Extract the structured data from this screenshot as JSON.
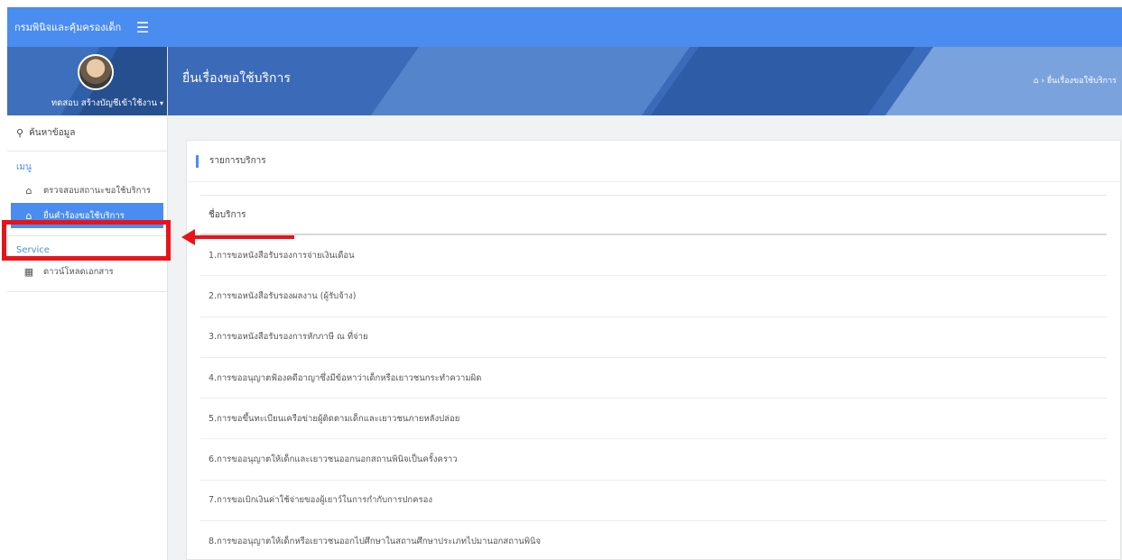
{
  "topbar": {
    "brand": "กรมพินิจและคุ้มครองเด็ก",
    "menu_icon": "hamburger-icon"
  },
  "profile": {
    "username": "ทดสอบ สร้างบัญชีเข้าใช้งาน",
    "caret": "▾"
  },
  "sidebar": {
    "search_label": "ค้นหาข้อมูล",
    "menu_section": "เมนู",
    "items": [
      {
        "label": "ตรวจสอบสถานะขอใช้บริการ",
        "icon": "home-icon"
      },
      {
        "label": "ยื่นคำร้องขอใช้บริการ",
        "icon": "home-icon"
      }
    ],
    "service_section": "Service",
    "service_items": [
      {
        "label": "ดาวน์โหลดเอกสาร",
        "icon": "grid-icon"
      }
    ]
  },
  "banner": {
    "title": "ยื่นเรื่องขอใช้บริการ",
    "breadcrumb": "ยื่นเรื่องขอใช้บริการ"
  },
  "card": {
    "header": "รายการบริการ",
    "column_header": "ชื่อบริการ",
    "rows": [
      "1.การขอหนังสือรับรองการจ่ายเงินเดือน",
      "2.การขอหนังสือรับรองผลงาน (ผู้รับจ้าง)",
      "3.การขอหนังสือรับรองการหักภาษี ณ ที่จ่าย",
      "4.การขออนุญาตฟ้องคดีอาญาซึ่งมีข้อหาว่าเด็กหรือเยาวชนกระทำความผิด",
      "5.การขอขึ้นทะเบียนเครือข่ายผู้ติดตามเด็กและเยาวชนภายหลังปล่อย",
      "6.การขออนุญาตให้เด็กและเยาวชนออกนอกสถานพินิจเป็นครั้งคราว",
      "7.การขอเบิกเงินค่าใช้จ่ายของผู้เยาว์ในการกำกับการปกครอง",
      "8.การขออนุญาตให้เด็กหรือเยาวชนออกไปศึกษาในสถานศึกษาประเภทไปมานอกสถานพินิจ"
    ]
  },
  "colors": {
    "accent": "#4a8cf0",
    "annotation": "#e8141a",
    "banner": "#3b6bb8"
  }
}
